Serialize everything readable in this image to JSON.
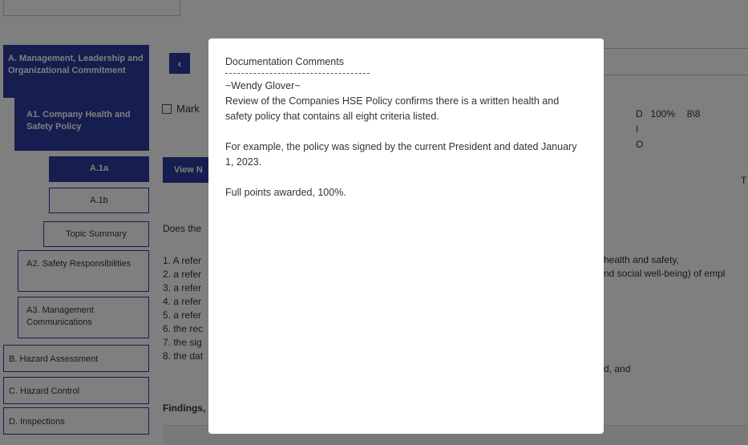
{
  "sidebar": {
    "items": [
      {
        "label": "A. Management, Leadership and Organizational Commitment"
      },
      {
        "label": "A1. Company Health and Safety Policy"
      },
      {
        "label": "A.1a"
      },
      {
        "label": "A.1b"
      },
      {
        "label": "Topic Summary"
      },
      {
        "label": "A2. Safety Responsibilities"
      },
      {
        "label": "A3. Management Communications"
      },
      {
        "label": "B. Hazard Assessment"
      },
      {
        "label": "C. Hazard Control"
      },
      {
        "label": "D. Inspections"
      }
    ]
  },
  "main": {
    "back_icon": "chevron-left-icon",
    "mark_label": "Mark",
    "view_button": "View N",
    "score": {
      "d": "D",
      "i": "I",
      "o": "O",
      "percent": "100%",
      "ratio": "8\\8"
    },
    "to_label": "T",
    "question": "Does the",
    "criteria": [
      "1. A refer",
      "2. a refer",
      "3. a refer",
      "4. a refer",
      "5. a refer",
      "6. the rec",
      "7. the sig",
      "8. the dat"
    ],
    "criteria_right": [
      "health and safety,",
      "nd social well-being) of empl",
      "d, and"
    ],
    "findings_label": "Findings,"
  },
  "modal": {
    "title": "Documentation Comments",
    "author": "~Wendy Glover~",
    "paragraphs": [
      "Review of the Companies HSE Policy confirms there is a written health and safety policy that contains all eight criteria listed.",
      "For example, the policy was signed by the current President and dated January 1, 2023.",
      "Full points awarded, 100%."
    ]
  },
  "colors": {
    "accent": "#2d3a9e",
    "overlay": "rgba(0,0,0,0.5)"
  }
}
